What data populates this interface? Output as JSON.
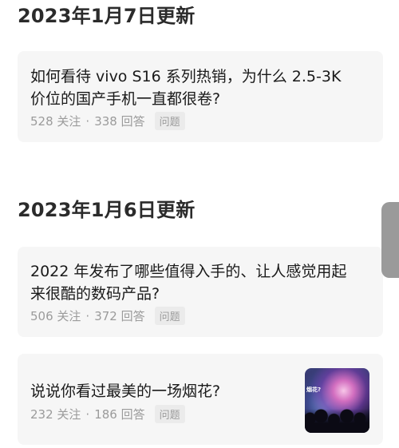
{
  "sections": [
    {
      "title": "2023年1月7日更新",
      "questions": [
        {
          "title_line1": "如何看待 vivo S16 系列热销，为什么 2.5-3K",
          "title_line2": "价位的国产手机一直都很卷?",
          "follows": "528 关注",
          "separator": "·",
          "answers": "338 回答",
          "tag": "问题"
        }
      ]
    },
    {
      "title": "2023年1月6日更新",
      "questions": [
        {
          "title_line1": "2022 年发布了哪些值得入手的、让人感觉用起",
          "title_line2": "来很酷的数码产品?",
          "follows": "506 关注",
          "separator": "·",
          "answers": "372 回答",
          "tag": "问题"
        },
        {
          "title_line1": "说说你看过最美的一场烟花?",
          "follows": "232 关注",
          "separator": "·",
          "answers": "186 回答",
          "tag": "问题",
          "thumbnail": {
            "icon": "fireworks-thumbnail",
            "overlay_text": "烟花?"
          }
        }
      ]
    }
  ]
}
